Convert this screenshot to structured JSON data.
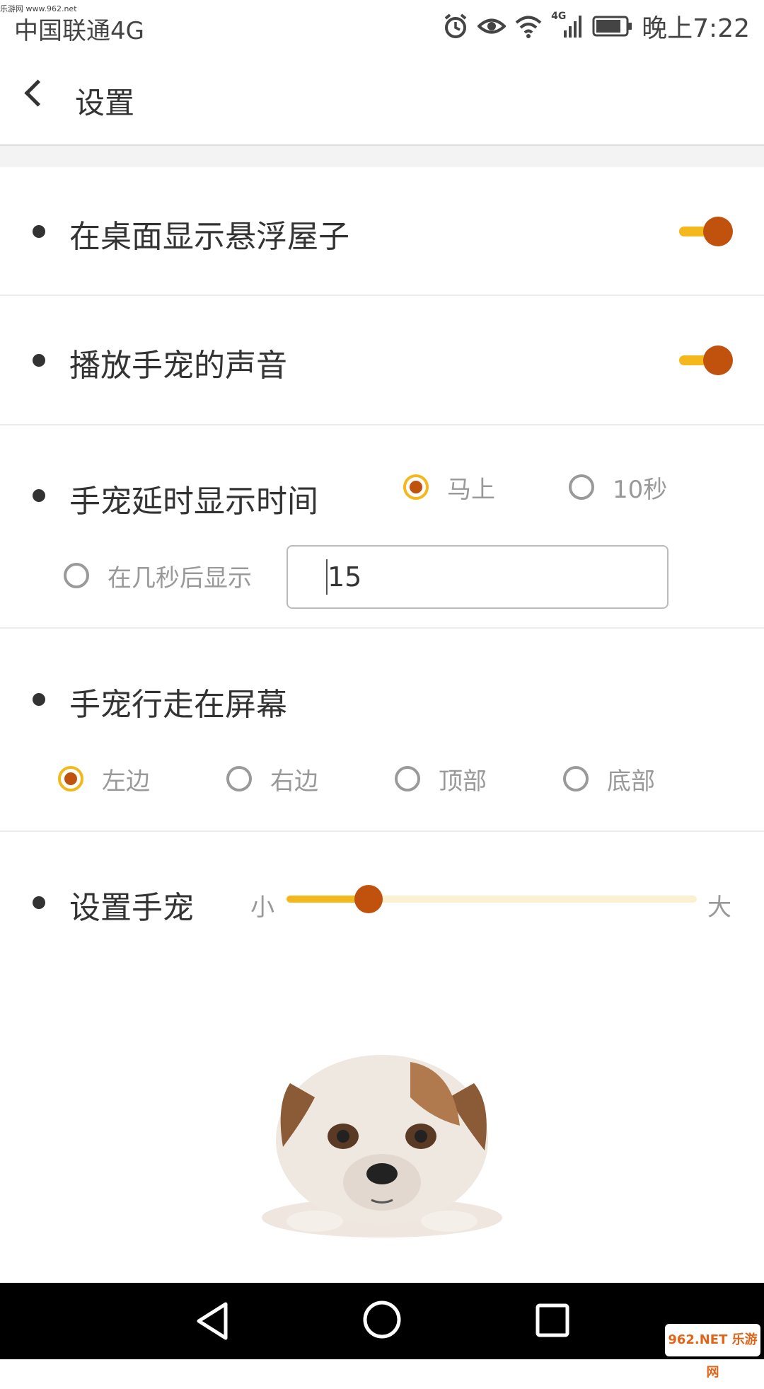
{
  "status_bar": {
    "watermark": "乐游网 www.962.net",
    "carrier": "中国联通4G",
    "network_type": "4G",
    "time": "晚上7:22",
    "icons": [
      "alarm-icon",
      "eye-icon",
      "wifi-icon",
      "signal-icon",
      "battery-icon"
    ]
  },
  "header": {
    "title": "设置",
    "back_icon": "back-arrow-icon"
  },
  "settings": {
    "show_house": {
      "label": "在桌面显示悬浮屋子",
      "enabled": true
    },
    "play_sound": {
      "label": "播放手宠的声音",
      "enabled": true
    },
    "delay": {
      "label": "手宠延时显示时间",
      "options": [
        "马上",
        "10秒",
        "在几秒后显示"
      ],
      "selected": "马上",
      "seconds_value": "15"
    },
    "walk": {
      "label": "手宠行走在屏幕",
      "options": [
        "左边",
        "右边",
        "顶部",
        "底部"
      ],
      "selected": "左边"
    },
    "size": {
      "label": "设置手宠",
      "min_label": "小",
      "max_label": "大",
      "value": 0.2
    }
  },
  "colors": {
    "accent": "#f5b81c",
    "knob": "#c0520e"
  },
  "nav_bar": {
    "icons": [
      "back-triangle-icon",
      "home-circle-icon",
      "recents-square-icon"
    ]
  },
  "corner_logo": "962.NET 乐游网"
}
